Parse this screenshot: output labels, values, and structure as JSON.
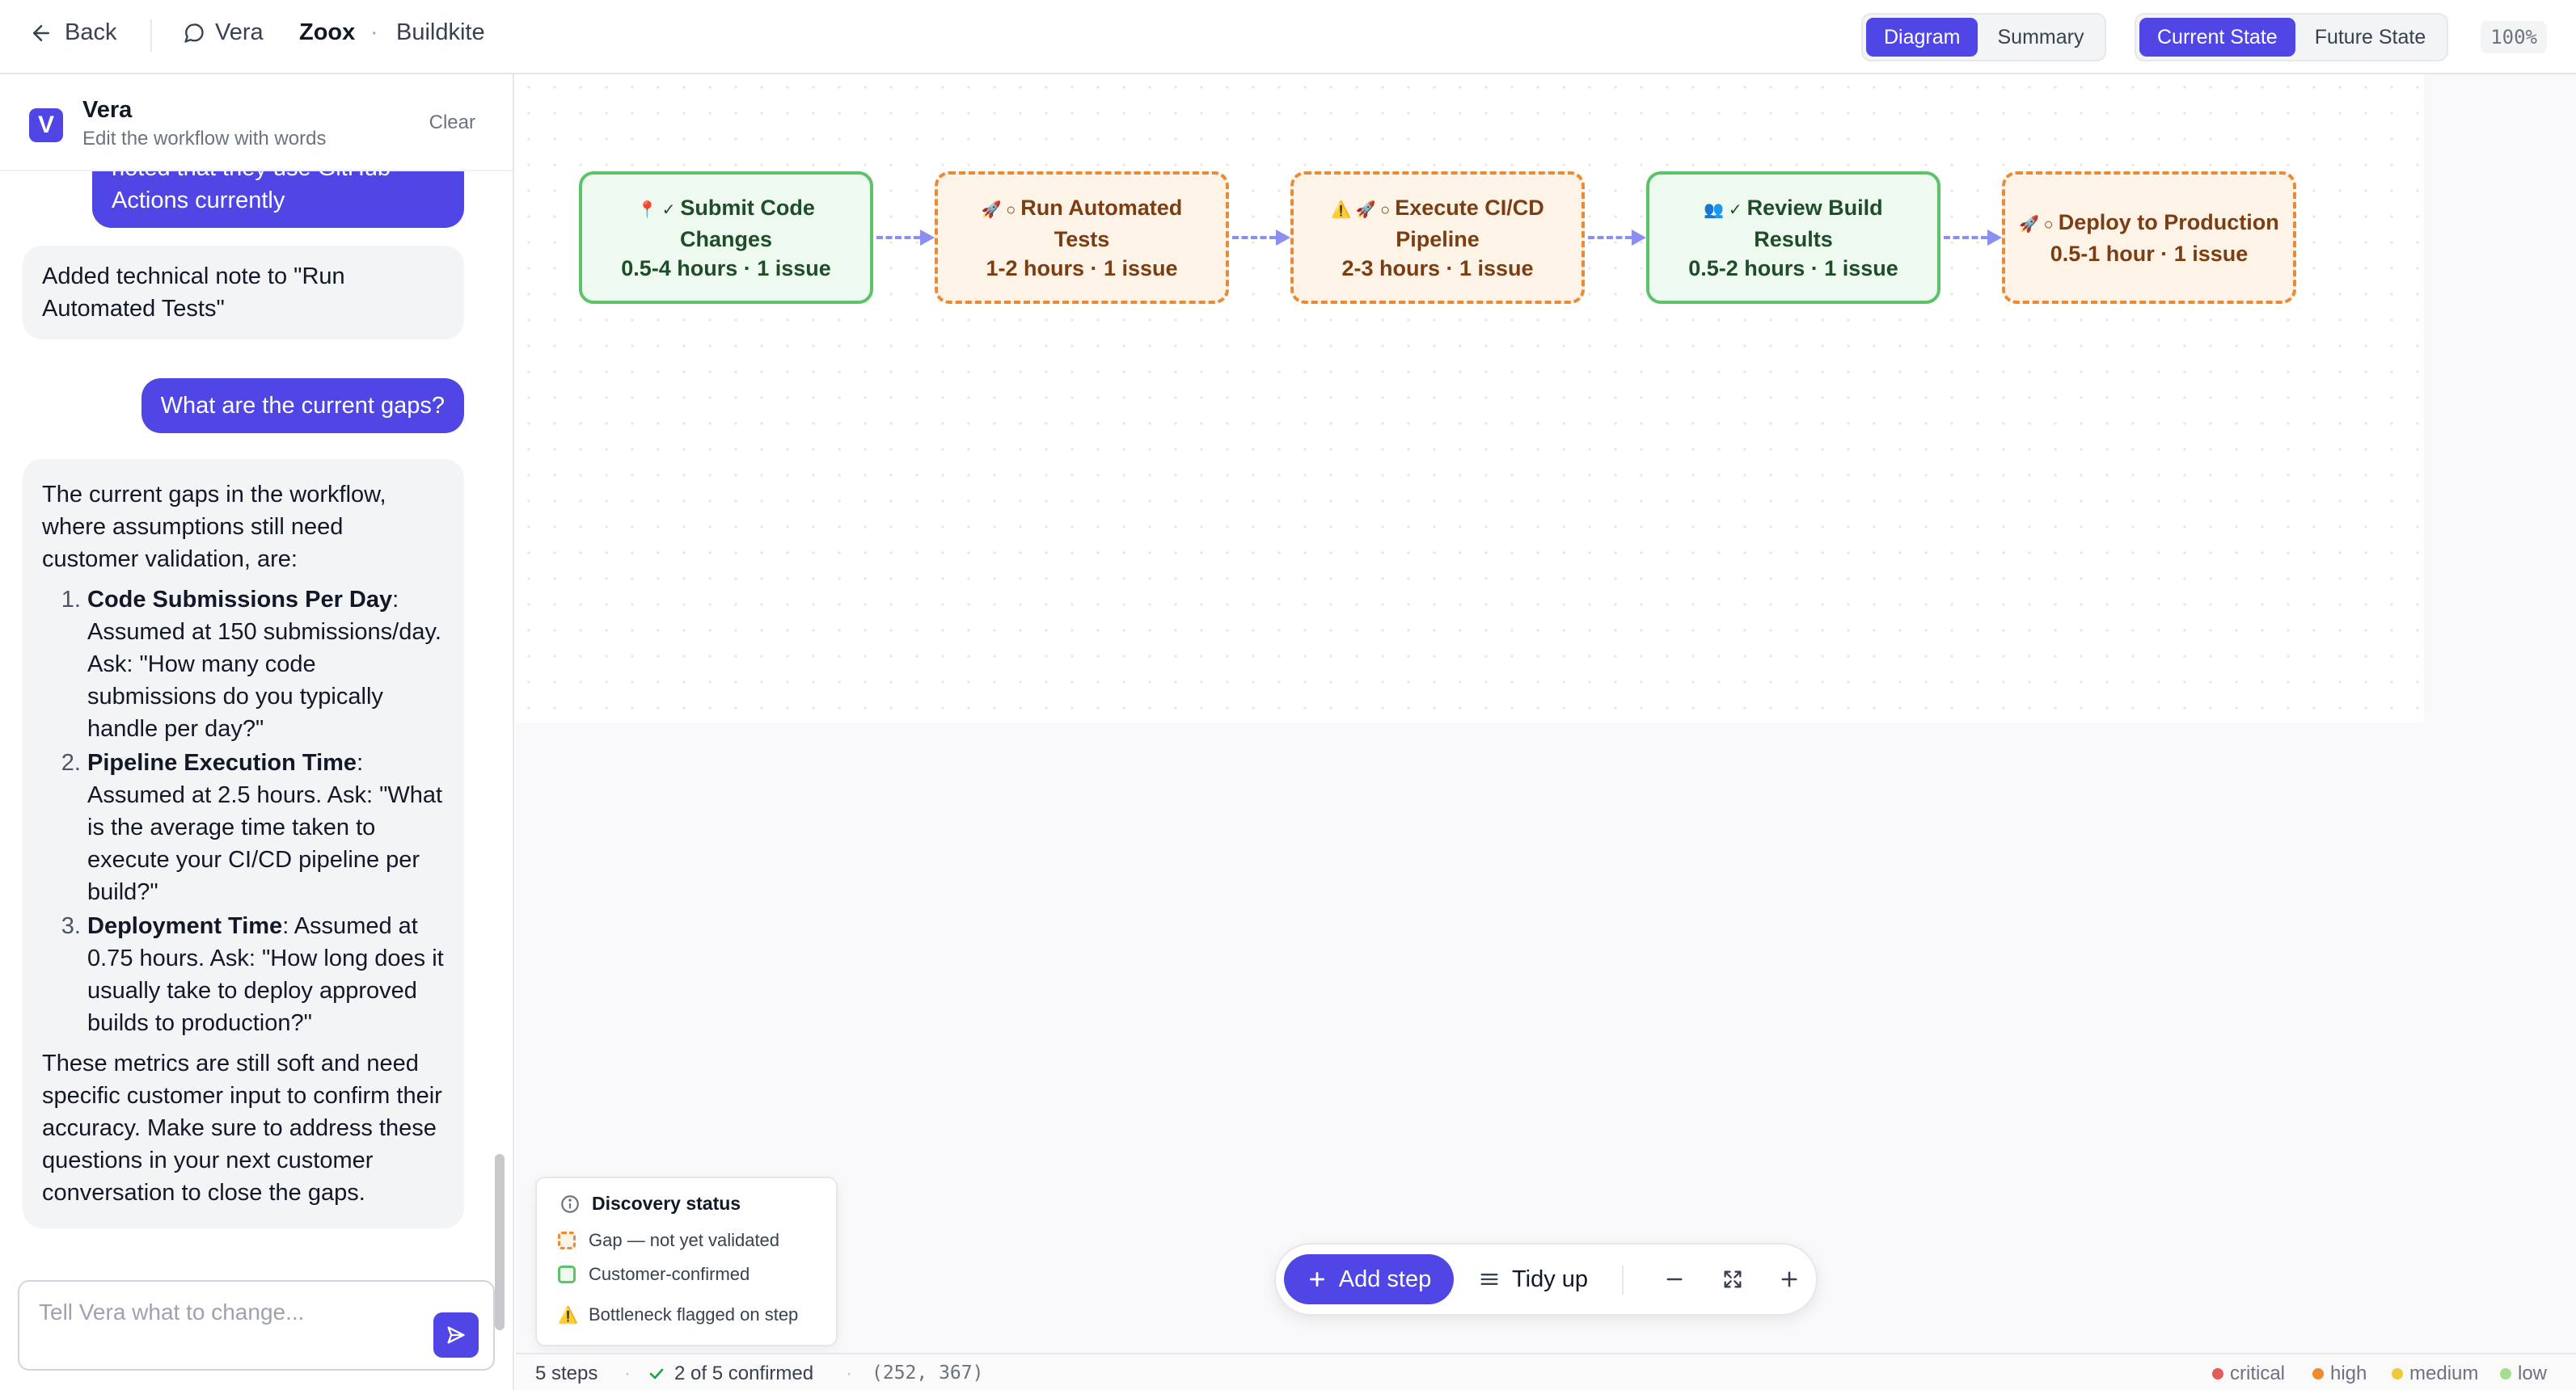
{
  "topbar": {
    "back_label": "Back",
    "crumbs": {
      "agent": "Vera",
      "org": "Zoox",
      "sep": "·",
      "project": "Buildkite"
    },
    "view_toggle": {
      "diagram": "Diagram",
      "summary": "Summary",
      "active": "Diagram"
    },
    "state_toggle": {
      "current": "Current State",
      "future": "Future State",
      "active": "Current State"
    },
    "zoom": "100%"
  },
  "sidebar": {
    "title": "Vera",
    "subtitle": "Edit the workflow with words",
    "clear_label": "Clear",
    "messages": {
      "user_1": "noted that they use GitHub Actions currently",
      "bot_1": "Added technical note to \"Run Automated Tests\"",
      "user_2": "What are the current gaps?",
      "bot_2": {
        "intro": "The current gaps in the workflow, where assumptions still need customer validation, are:",
        "items": [
          {
            "title": "Code Submissions Per Day",
            "text": ": Assumed at 150 submissions/day. Ask: \"How many code submissions do you typically handle per day?\""
          },
          {
            "title": "Pipeline Execution Time",
            "text": ": Assumed at 2.5 hours. Ask: \"What is the average time taken to execute your CI/CD pipeline per build?\""
          },
          {
            "title": "Deployment Time",
            "text": ": Assumed at 0.75 hours. Ask: \"How long does it usually take to deploy approved builds to production?\""
          }
        ],
        "outro": "These metrics are still soft and need specific customer input to confirm their accuracy. Make sure to address these questions in your next customer conversation to close the gaps."
      }
    },
    "composer": {
      "placeholder": "Tell Vera what to change...",
      "value": ""
    }
  },
  "diagram": {
    "nodes": [
      {
        "icons": "📍 ✓",
        "title": "Submit Code Changes",
        "title_l1": "Submit Code",
        "title_l2": "Changes",
        "meta": "0.5-4 hours · 1 issue",
        "status": "confirmed"
      },
      {
        "icons": "🚀 ○",
        "title": "Run Automated Tests",
        "meta": "1-2 hours · 1 issue",
        "status": "gap"
      },
      {
        "icons": "⚠️ 🚀 ○",
        "title": "Execute CI/CD Pipeline",
        "title_l1": "Execute CI/CD",
        "title_l2": "Pipeline",
        "meta": "2-3 hours · 1 issue",
        "status": "gap"
      },
      {
        "icons": "👥 ✓",
        "title": "Review Build Results",
        "meta": "0.5-2 hours · 1 issue",
        "status": "confirmed"
      },
      {
        "icons": "🚀 ○",
        "title": "Deploy to Production",
        "meta": "0.5-1 hour · 1 issue",
        "status": "gap"
      }
    ],
    "colors": {
      "gap_border": "#ea8a35",
      "gap_fill": "#fdf3e7",
      "ok_border": "#5cc36a",
      "ok_fill": "#eefaf0",
      "edge": "#8b8ff0",
      "accent": "#4f46e5"
    }
  },
  "legend": {
    "title": "Discovery status",
    "gap": "Gap — not yet validated",
    "confirmed": "Customer-confirmed",
    "bottleneck": "Bottleneck flagged on step"
  },
  "toolbar": {
    "add_step": "Add step",
    "tidy_up": "Tidy up"
  },
  "statusbar": {
    "steps": "5 steps",
    "confirmed": "2 of 5 confirmed",
    "coords": "(252, 367)",
    "severity": [
      {
        "label": "critical",
        "color": "#e25c5c"
      },
      {
        "label": "high",
        "color": "#ef8a2e"
      },
      {
        "label": "medium",
        "color": "#f0c93a"
      },
      {
        "label": "low",
        "color": "#a6dc8f"
      }
    ]
  }
}
